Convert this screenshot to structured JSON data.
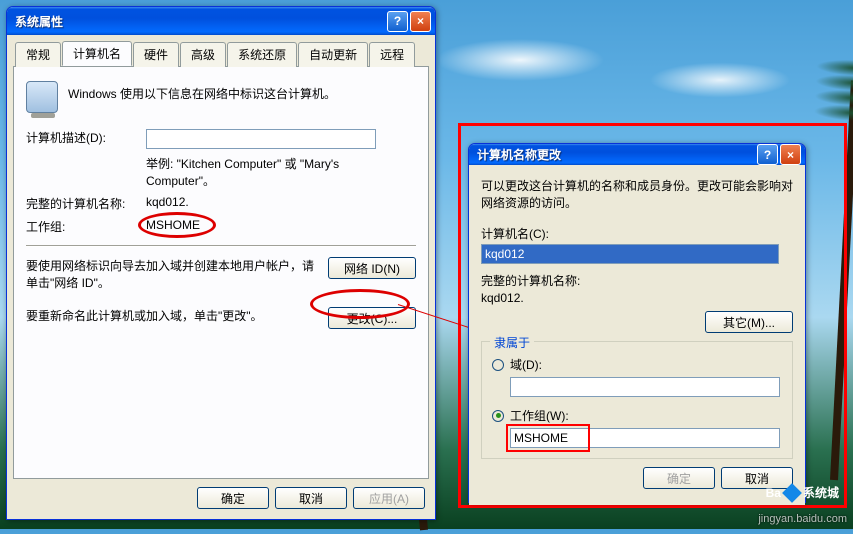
{
  "bg": {
    "watermark": "jingyan.baidu.com",
    "logo": "Ba",
    "logo2": "系统城"
  },
  "win1": {
    "title": "系统属性",
    "tabs": [
      "常规",
      "计算机名",
      "硬件",
      "高级",
      "系统还原",
      "自动更新",
      "远程"
    ],
    "intro": "Windows 使用以下信息在网络中标识这台计算机。",
    "desc_label": "计算机描述(D):",
    "desc_example": "举例:  \"Kitchen Computer\" 或 \"Mary's Computer\"。",
    "fullname_label": "完整的计算机名称:",
    "fullname_value": "kqd012.",
    "workgroup_label": "工作组:",
    "workgroup_value": "MSHOME",
    "netid_text": "要使用网络标识向导去加入域并创建本地用户帐户，请单击\"网络 ID\"。",
    "netid_btn": "网络 ID(N)",
    "change_text": "要重新命名此计算机或加入域，单击\"更改\"。",
    "change_btn": "更改(C)...",
    "ok": "确定",
    "cancel": "取消",
    "apply": "应用(A)"
  },
  "win2": {
    "title": "计算机名称更改",
    "intro": "可以更改这台计算机的名称和成员身份。更改可能会影响对网络资源的访问。",
    "name_label": "计算机名(C):",
    "name_value": "kqd012",
    "fullname_label": "完整的计算机名称:",
    "fullname_value": "kqd012.",
    "more_btn": "其它(M)...",
    "legend": "隶属于",
    "domain_label": "域(D):",
    "workgroup_label": "工作组(W):",
    "workgroup_value": "MSHOME",
    "ok": "确定",
    "cancel": "取消"
  }
}
